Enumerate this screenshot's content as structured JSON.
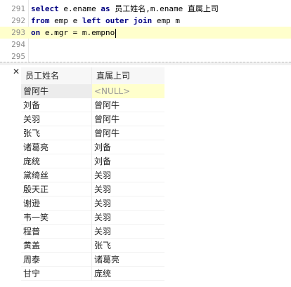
{
  "editor": {
    "lines": [
      {
        "num": "291",
        "parts": [
          {
            "t": "select",
            "kw": true
          },
          {
            "t": " e.ename "
          },
          {
            "t": "as",
            "kw": true
          },
          {
            "t": " "
          },
          {
            "t": "员工姓名",
            "cjk": true
          },
          {
            "t": ",m.ename "
          },
          {
            "t": "直属上司",
            "cjk": true
          }
        ]
      },
      {
        "num": "292",
        "parts": [
          {
            "t": "from",
            "kw": true
          },
          {
            "t": " emp e "
          },
          {
            "t": "left outer join",
            "kw": true
          },
          {
            "t": " emp m"
          }
        ]
      },
      {
        "num": "293",
        "current": true,
        "caret": true,
        "parts": [
          {
            "t": "on",
            "kw": true
          },
          {
            "t": " e.mgr = m.empno"
          }
        ]
      },
      {
        "num": "294",
        "parts": []
      },
      {
        "num": "295",
        "parts": []
      }
    ]
  },
  "results": {
    "close_symbol": "✕",
    "columns": [
      "员工姓名",
      "直属上司"
    ],
    "rows": [
      [
        "曾阿牛",
        "<NULL>"
      ],
      [
        "刘备",
        "曾阿牛"
      ],
      [
        "关羽",
        "曾阿牛"
      ],
      [
        "张飞",
        "曾阿牛"
      ],
      [
        "诸葛亮",
        "刘备"
      ],
      [
        "庞统",
        "刘备"
      ],
      [
        "黛绮丝",
        "关羽"
      ],
      [
        "殷天正",
        "关羽"
      ],
      [
        "谢逊",
        "关羽"
      ],
      [
        "韦一笑",
        "关羽"
      ],
      [
        "程普",
        "关羽"
      ],
      [
        "黄盖",
        "张飞"
      ],
      [
        "周泰",
        "诸葛亮"
      ],
      [
        "甘宁",
        "庞统"
      ]
    ],
    "selected_row": 0
  }
}
